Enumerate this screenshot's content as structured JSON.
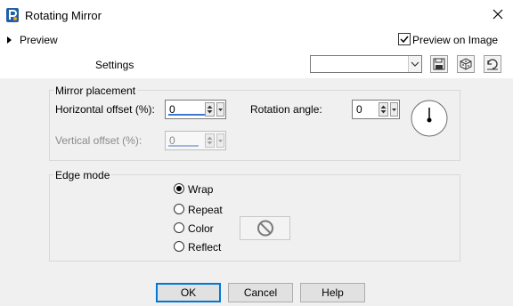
{
  "window": {
    "title": "Rotating Mirror"
  },
  "top": {
    "preview_label": "Preview",
    "preview_on_image_label": "Preview on Image",
    "preview_on_image_checked": true,
    "settings_label": "Settings",
    "settings_value": ""
  },
  "icons": {
    "app": "psp-app-icon",
    "close": "close-icon",
    "save": "save-preset-icon",
    "random": "randomize-dice-icon",
    "reset": "reset-icon",
    "dial": "rotation-dial-icon",
    "no_color": "no-color-icon"
  },
  "mirror_placement": {
    "group_label": "Mirror placement",
    "horizontal_label": "Horizontal offset (%):",
    "horizontal_value": "0",
    "vertical_label": "Vertical offset (%):",
    "vertical_value": "0",
    "rotation_label": "Rotation angle:",
    "rotation_value": "0"
  },
  "edge_mode": {
    "group_label": "Edge mode",
    "options": [
      "Wrap",
      "Repeat",
      "Color",
      "Reflect"
    ],
    "selected": "Wrap"
  },
  "buttons": {
    "ok": "OK",
    "cancel": "Cancel",
    "help": "Help"
  },
  "colors": {
    "accent": "#0078d7",
    "underline": "#3c78d8",
    "background": "#f0f0f0"
  }
}
